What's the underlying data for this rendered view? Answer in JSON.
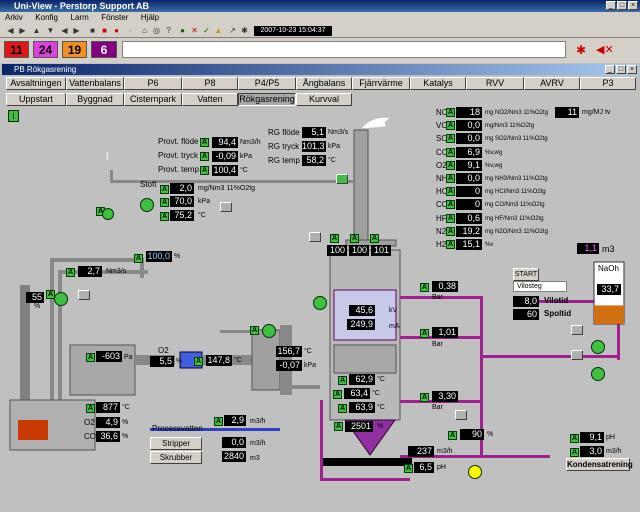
{
  "window": {
    "title": "Uni-View - Perstorp Support AB"
  },
  "menu": [
    "Arkiv",
    "Konfig",
    "Larm",
    "Fönster",
    "Hjälp"
  ],
  "clock": "2007-10-23 15:04:37",
  "alarms": [
    {
      "v": "11",
      "color": "#e01818"
    },
    {
      "v": "24",
      "color": "#e040e0"
    },
    {
      "v": "19",
      "color": "#f09020"
    },
    {
      "v": "6",
      "color": "#800080"
    }
  ],
  "panel_title": "PB Rökgasrening",
  "tabs1": [
    "Avsaltningen",
    "Vattenbalans",
    "P6",
    "P8",
    "P4/P5",
    "Ångbalans",
    "Fjärrvärme",
    "Katalys",
    "RVV",
    "AVRV",
    "P3"
  ],
  "tabs2": [
    "Uppstart",
    "Byggnad",
    "Cisternpark",
    "Vatten",
    "Rökgasrening",
    "Kurvval"
  ],
  "provt": {
    "flode_l": "Provt. flöde",
    "flode_v": "94,4",
    "flode_u": "Nm3/h",
    "tryck_l": "Provt. tryck",
    "tryck_v": "-0,09",
    "tryck_u": "kPa",
    "temp_l": "Provt. temp",
    "temp_v": "100,4",
    "temp_u": "°C"
  },
  "rg": {
    "flode_l": "RG flöde",
    "flode_v": "5,1",
    "flode_u": "Nm3/s",
    "tryck_l": "RG tryck",
    "tryck_v": "101,3",
    "tryck_u": "kPa",
    "temp_l": "RG temp",
    "temp_v": "58,2",
    "temp_u": "°C"
  },
  "stoft": {
    "label": "Stoft",
    "v1": "2,0",
    "u1": "mg/Nm3 11%O2tg",
    "v2": "70,0",
    "u2": "kPa",
    "v3": "75,2",
    "u3": "°C"
  },
  "emissions": [
    {
      "n": "NOx",
      "v": "18",
      "u": "mg NO2/Nm3 11%O2tg"
    },
    {
      "n": "VOC",
      "v": "0,0",
      "u": "mg/Nm3 11%O2tg"
    },
    {
      "n": "SO2",
      "v": "0,0",
      "u": "mg SO2/Nm3 11%O2tg"
    },
    {
      "n": "CO2",
      "v": "6,9",
      "u": "%v,wg"
    },
    {
      "n": "O2",
      "v": "9,1",
      "u": "%v,wg"
    },
    {
      "n": "NH3",
      "v": "0,0",
      "u": "mg NH3/Nm3 11%O2tg"
    },
    {
      "n": "HCl",
      "v": "0",
      "u": "mg HCl/Nm3 11%O2tg"
    },
    {
      "n": "CO",
      "v": "0",
      "u": "mg CO/Nm3 11%O2tg"
    },
    {
      "n": "HF",
      "v": "0,6",
      "u": "mg HF/Nm3 11%O2tg"
    },
    {
      "n": "N2O",
      "v": "19,2",
      "u": "mg N2O/Nm3 11%O2tg"
    },
    {
      "n": "H2O",
      "v": "15,1",
      "u": "%v"
    }
  ],
  "nox_mj": {
    "v": "11",
    "u": "mg/MJ tv"
  },
  "stack": {
    "v1": "100",
    "v2": "100",
    "v3": "101"
  },
  "left": {
    "flow_v": "2,7",
    "flow_u": "Nm3/s",
    "top_v": "100,0",
    "top_u": "%",
    "fan_v": "55",
    "fan_u": "%",
    "pa_v": "-603",
    "pa_u": "Pa",
    "o2_l": "O2",
    "o2_v": "5,5",
    "o2_u": "%",
    "hx_v": "147,8",
    "hx_u": "°C",
    "t_v": "877",
    "t_u": "°C",
    "o2b_l": "O2",
    "o2b_v": "4,9",
    "o2b_u": "%",
    "co_l": "CO",
    "co_v": "36,6",
    "co_u": "%"
  },
  "duct": {
    "t_v": "156,7",
    "t_u": "°C",
    "p_v": "-0,07",
    "p_u": "kPa"
  },
  "scrubber": {
    "v1": "45,6",
    "u1": "kV",
    "v2": "249,9",
    "u2": "mA",
    "t1": "62,9",
    "t2": "63,4",
    "t3": "63,9",
    "tu": "°C",
    "tank": "2501",
    "tank_u": "%"
  },
  "bars": [
    {
      "v": "0,38",
      "u": "Bar"
    },
    {
      "v": "1,01",
      "u": "Bar"
    },
    {
      "v": "3,30",
      "u": "Bar"
    }
  ],
  "naoh": {
    "label": "NaOh",
    "level_v": "1,1",
    "level_u": "m3",
    "v": "33,7",
    "level_fraction": 0.3
  },
  "start": {
    "btn": "START",
    "mode": "Vilosteg",
    "vilotid_v": "8,0",
    "vilotid_l": "Vilotid",
    "spoltid_v": "60",
    "spoltid_l": "Spoltid"
  },
  "bottom": {
    "process_l": "Processvatten",
    "process_v": "2,9",
    "process_u": "m3/h",
    "stripper_l": "Stripper",
    "stripper_v": "0,0",
    "stripper_u": "m3/h",
    "skrubber_l": "Skrubber",
    "skrubber_v": "2840",
    "skrubber_u": "m3",
    "flow_v": "237",
    "flow_u": "m3/h",
    "ph_v": "6,5",
    "ph_u": "pH",
    "valve_v": "90",
    "valve_u": "%",
    "ph2_v": "9,1",
    "ph2_u": "pH",
    "q_v": "3,0",
    "q_u": "m3/h",
    "kond": "Kondensatrening"
  }
}
